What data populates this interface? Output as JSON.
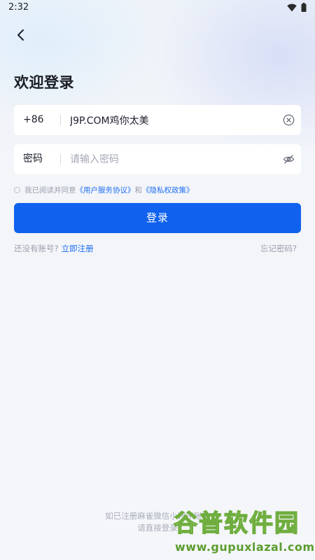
{
  "status_bar": {
    "time": "2:32"
  },
  "header": {
    "title": "欢迎登录"
  },
  "phone_field": {
    "country_code": "+86",
    "value": "J9P.COM鸡你太美"
  },
  "password_field": {
    "label": "密码",
    "placeholder": "请输入密码"
  },
  "agreement": {
    "prefix": "我已阅读并同意",
    "user_agreement": "《用户服务协议》",
    "conjunction": "和",
    "privacy_policy": "《隐私权政策》"
  },
  "login_button": {
    "label": "登录"
  },
  "register": {
    "prompt": "还没有账号?",
    "link": "立即注册"
  },
  "forgot_password": {
    "label": "忘记密码?"
  },
  "footer": {
    "line1": "如已注册麻雀微信小程序账号",
    "line2": "请直接登录"
  },
  "watermark": {
    "logo_text": "谷普软件园",
    "url": "www.gupuxlazal.com"
  },
  "colors": {
    "primary": "#1062ee",
    "link": "#1f6ff2",
    "background": "#f4f6fa",
    "text": "#1b1f2a",
    "muted": "#9aa0ab"
  },
  "icons": {
    "back": "chevron-left-icon",
    "wifi": "wifi-icon",
    "battery": "battery-icon",
    "clear": "clear-circle-icon",
    "password_visibility": "eye-off-icon"
  }
}
